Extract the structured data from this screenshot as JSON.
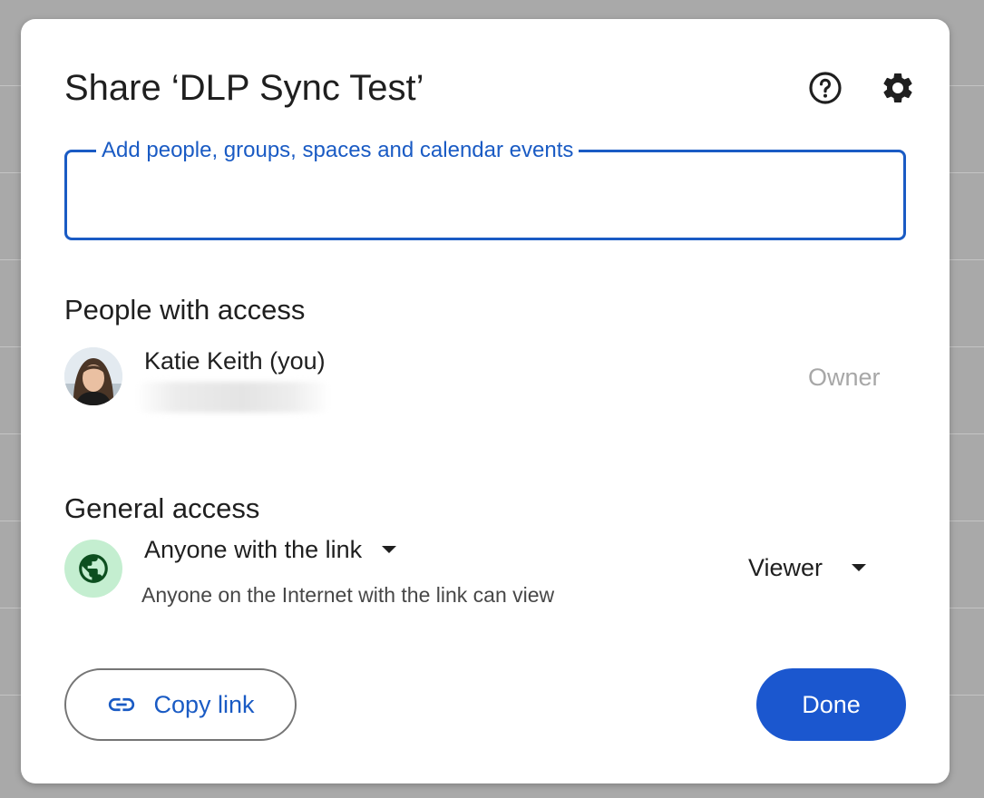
{
  "dialog": {
    "title": "Share ‘DLP Sync Test’",
    "help_icon": "help-circle-icon",
    "settings_icon": "gear-icon"
  },
  "add_people": {
    "label": "Add people, groups, spaces and calendar events",
    "value": ""
  },
  "people_with_access": {
    "heading": "People with access",
    "people": [
      {
        "name": "Katie Keith (you)",
        "role": "Owner"
      }
    ]
  },
  "general_access": {
    "heading": "General access",
    "scope": "Anyone with the link",
    "description": "Anyone on the Internet with the link can view",
    "role": "Viewer",
    "icon": "globe-icon"
  },
  "actions": {
    "copy_link_label": "Copy link",
    "done_label": "Done"
  },
  "colors": {
    "accent": "#1a5bc4",
    "done_button": "#1b57cf",
    "globe_bg": "#c4eed0"
  }
}
